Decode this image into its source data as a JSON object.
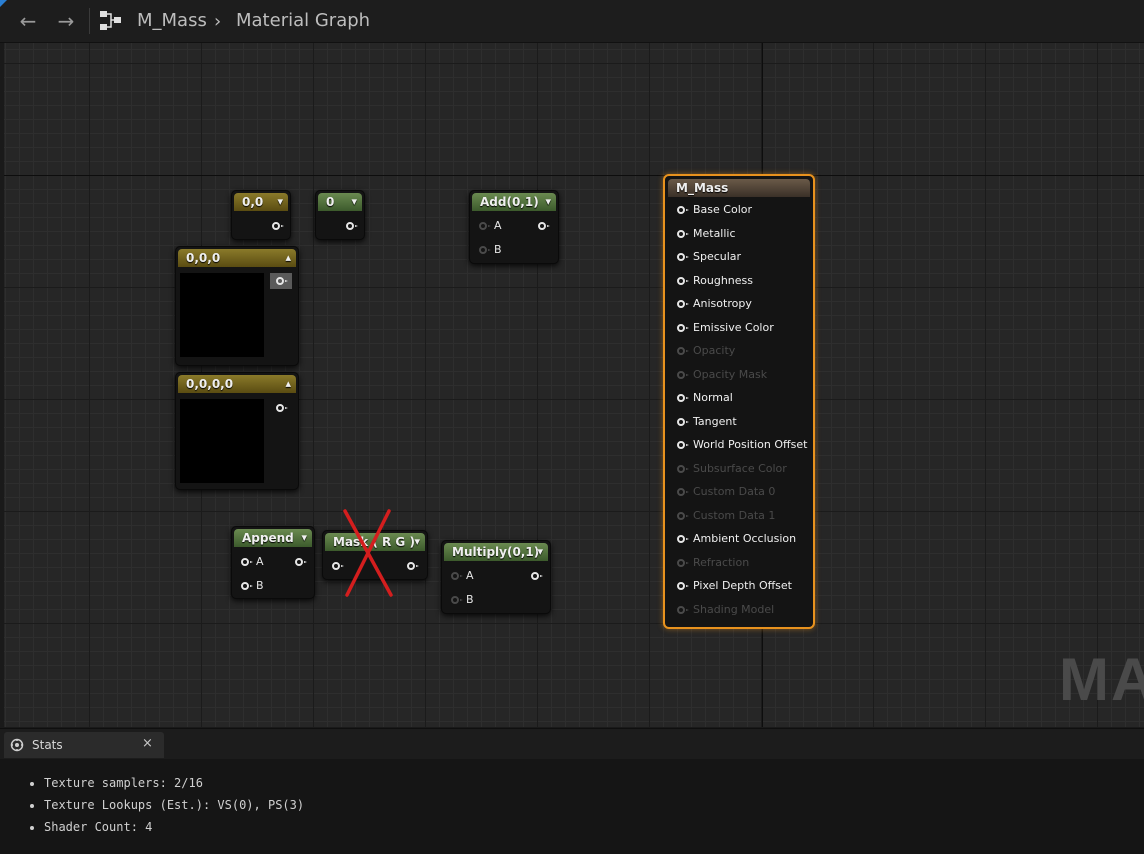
{
  "toolbar": {
    "back_icon": "←",
    "forward_icon": "→",
    "graph_icon_name": "material-graph-icon",
    "asset_name": "M_Mass",
    "breadcrumb_separator": "›",
    "graph_name": "Material Graph"
  },
  "graph": {
    "watermark": "MAT",
    "nodes": {
      "const2": {
        "title": "0,0",
        "chevron": "▾"
      },
      "const1": {
        "title": "0",
        "chevron": "▾"
      },
      "add": {
        "title": "Add(0,1)",
        "chevron": "▾",
        "pin_a": "A",
        "pin_b": "B"
      },
      "const3": {
        "title": "0,0,0",
        "chevron": "▴"
      },
      "const4": {
        "title": "0,0,0,0",
        "chevron": "▴"
      },
      "append": {
        "title": "Append",
        "chevron": "▾",
        "pin_a": "A",
        "pin_b": "B"
      },
      "mask": {
        "title": "Mask ( R G )",
        "chevron": "▾",
        "state": "disabled-crossed"
      },
      "multiply": {
        "title": "Multiply(0,1)",
        "chevron": "▾",
        "pin_a": "A",
        "pin_b": "B"
      }
    },
    "result_node": {
      "title": "M_Mass",
      "accent_color": "#e8921e",
      "inputs": [
        {
          "label": "Base Color",
          "enabled": true
        },
        {
          "label": "Metallic",
          "enabled": true
        },
        {
          "label": "Specular",
          "enabled": true
        },
        {
          "label": "Roughness",
          "enabled": true
        },
        {
          "label": "Anisotropy",
          "enabled": true
        },
        {
          "label": "Emissive Color",
          "enabled": true
        },
        {
          "label": "Opacity",
          "enabled": false
        },
        {
          "label": "Opacity Mask",
          "enabled": false
        },
        {
          "label": "Normal",
          "enabled": true
        },
        {
          "label": "Tangent",
          "enabled": true
        },
        {
          "label": "World Position Offset",
          "enabled": true
        },
        {
          "label": "Subsurface Color",
          "enabled": false
        },
        {
          "label": "Custom Data 0",
          "enabled": false
        },
        {
          "label": "Custom Data 1",
          "enabled": false
        },
        {
          "label": "Ambient Occlusion",
          "enabled": true
        },
        {
          "label": "Refraction",
          "enabled": false
        },
        {
          "label": "Pixel Depth Offset",
          "enabled": true
        },
        {
          "label": "Shading Model",
          "enabled": false
        }
      ]
    }
  },
  "stats_panel": {
    "tab_label": "Stats",
    "close_icon": "×",
    "lines": [
      "Texture samplers: 2/16",
      "Texture Lookups (Est.): VS(0), PS(3)",
      "Shader Count: 4"
    ]
  }
}
